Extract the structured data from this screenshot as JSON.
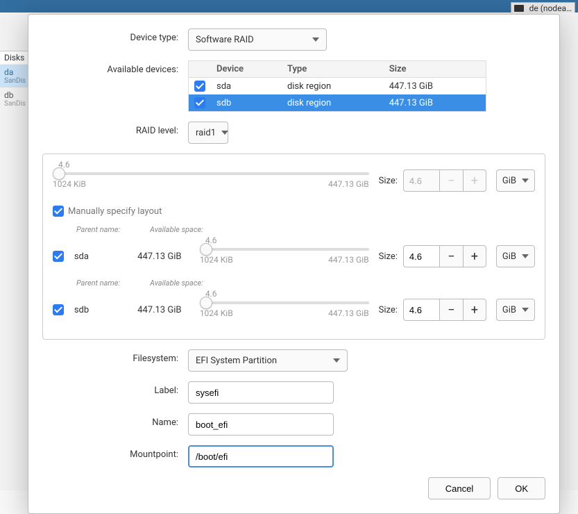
{
  "topbar": {
    "kb": "de (nodea…"
  },
  "background": {
    "disks_label": "Disks",
    "sidebar": [
      {
        "name": "da",
        "sub": "SanDis"
      },
      {
        "name": "db",
        "sub": "SanDis"
      }
    ]
  },
  "dialog": {
    "device_type": {
      "label": "Device type:",
      "value": "Software RAID"
    },
    "available_devices": {
      "label": "Available devices:",
      "headers": {
        "device": "Device",
        "type": "Type",
        "size": "Size"
      },
      "rows": [
        {
          "checked": true,
          "device": "sda",
          "type": "disk region",
          "size": "447.13 GiB",
          "selected": false
        },
        {
          "checked": true,
          "device": "sdb",
          "type": "disk region",
          "size": "447.13 GiB",
          "selected": true
        }
      ]
    },
    "raid_level": {
      "label": "RAID level:",
      "value": "raid1"
    },
    "overall_size": {
      "value_top": "4.6",
      "min": "1024 KiB",
      "max": "447.13 GiB",
      "size_label": "Size:",
      "size_value": "4.6",
      "unit": "GiB"
    },
    "manual_layout": {
      "label": "Manually specify layout",
      "checked": true
    },
    "layout_headers": {
      "parent": "Parent name:",
      "space": "Available space:"
    },
    "layout_rows": [
      {
        "checked": true,
        "parent": "sda",
        "space": "447.13 GiB",
        "slider_top": "4.6",
        "min": "1024 KiB",
        "max": "447.13 GiB",
        "size_label": "Size:",
        "size_value": "4.6",
        "unit": "GiB"
      },
      {
        "checked": true,
        "parent": "sdb",
        "space": "447.13 GiB",
        "slider_top": "4.6",
        "min": "1024 KiB",
        "max": "447.13 GiB",
        "size_label": "Size:",
        "size_value": "4.6",
        "unit": "GiB"
      }
    ],
    "filesystem": {
      "label": "Filesystem:",
      "value": "EFI System Partition"
    },
    "label_field": {
      "label": "Label:",
      "value": "sysefi"
    },
    "name_field": {
      "label": "Name:",
      "value": "boot_efi"
    },
    "mountpoint": {
      "label": "Mountpoint:",
      "value": "/boot/efi"
    },
    "buttons": {
      "cancel": "Cancel",
      "ok": "OK"
    }
  },
  "glyphs": {
    "minus": "−",
    "plus": "+"
  }
}
